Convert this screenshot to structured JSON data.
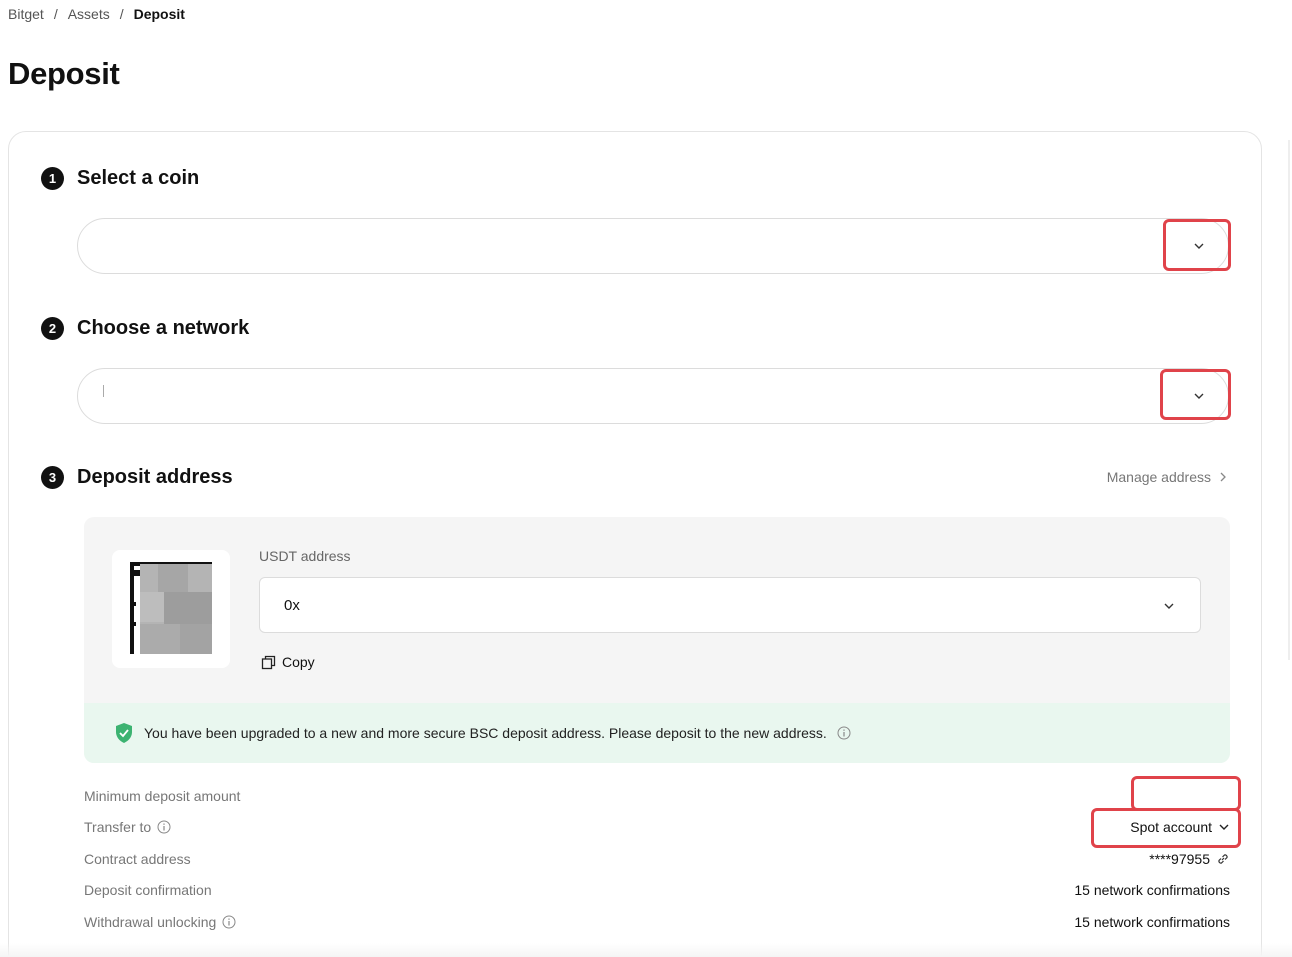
{
  "breadcrumb": {
    "items": [
      "Bitget",
      "Assets"
    ],
    "current": "Deposit",
    "separator": "/"
  },
  "page": {
    "title": "Deposit"
  },
  "steps": {
    "coin": {
      "number": "1",
      "title": "Select a coin"
    },
    "network": {
      "number": "2",
      "title": "Choose a network"
    },
    "address": {
      "number": "3",
      "title": "Deposit address"
    }
  },
  "manage_address": "Manage address",
  "address_box": {
    "label": "USDT address",
    "value": "0x",
    "copy_label": "Copy"
  },
  "notice": {
    "text": "You have been upgraded to a new and more secure BSC deposit address. Please deposit to the new address."
  },
  "details": {
    "min_deposit": {
      "label": "Minimum deposit amount",
      "value": ""
    },
    "transfer_to": {
      "label": "Transfer to",
      "value": "Spot account"
    },
    "contract": {
      "label": "Contract address",
      "value": "****97955"
    },
    "deposit_confirmation": {
      "label": "Deposit confirmation",
      "value": "15 network confirmations"
    },
    "withdrawal_unlocking": {
      "label": "Withdrawal unlocking",
      "value": "15 network confirmations"
    }
  },
  "colors": {
    "highlight": "#e0434a",
    "notice_bg": "#e9f7ef",
    "shield": "#3cb371"
  }
}
